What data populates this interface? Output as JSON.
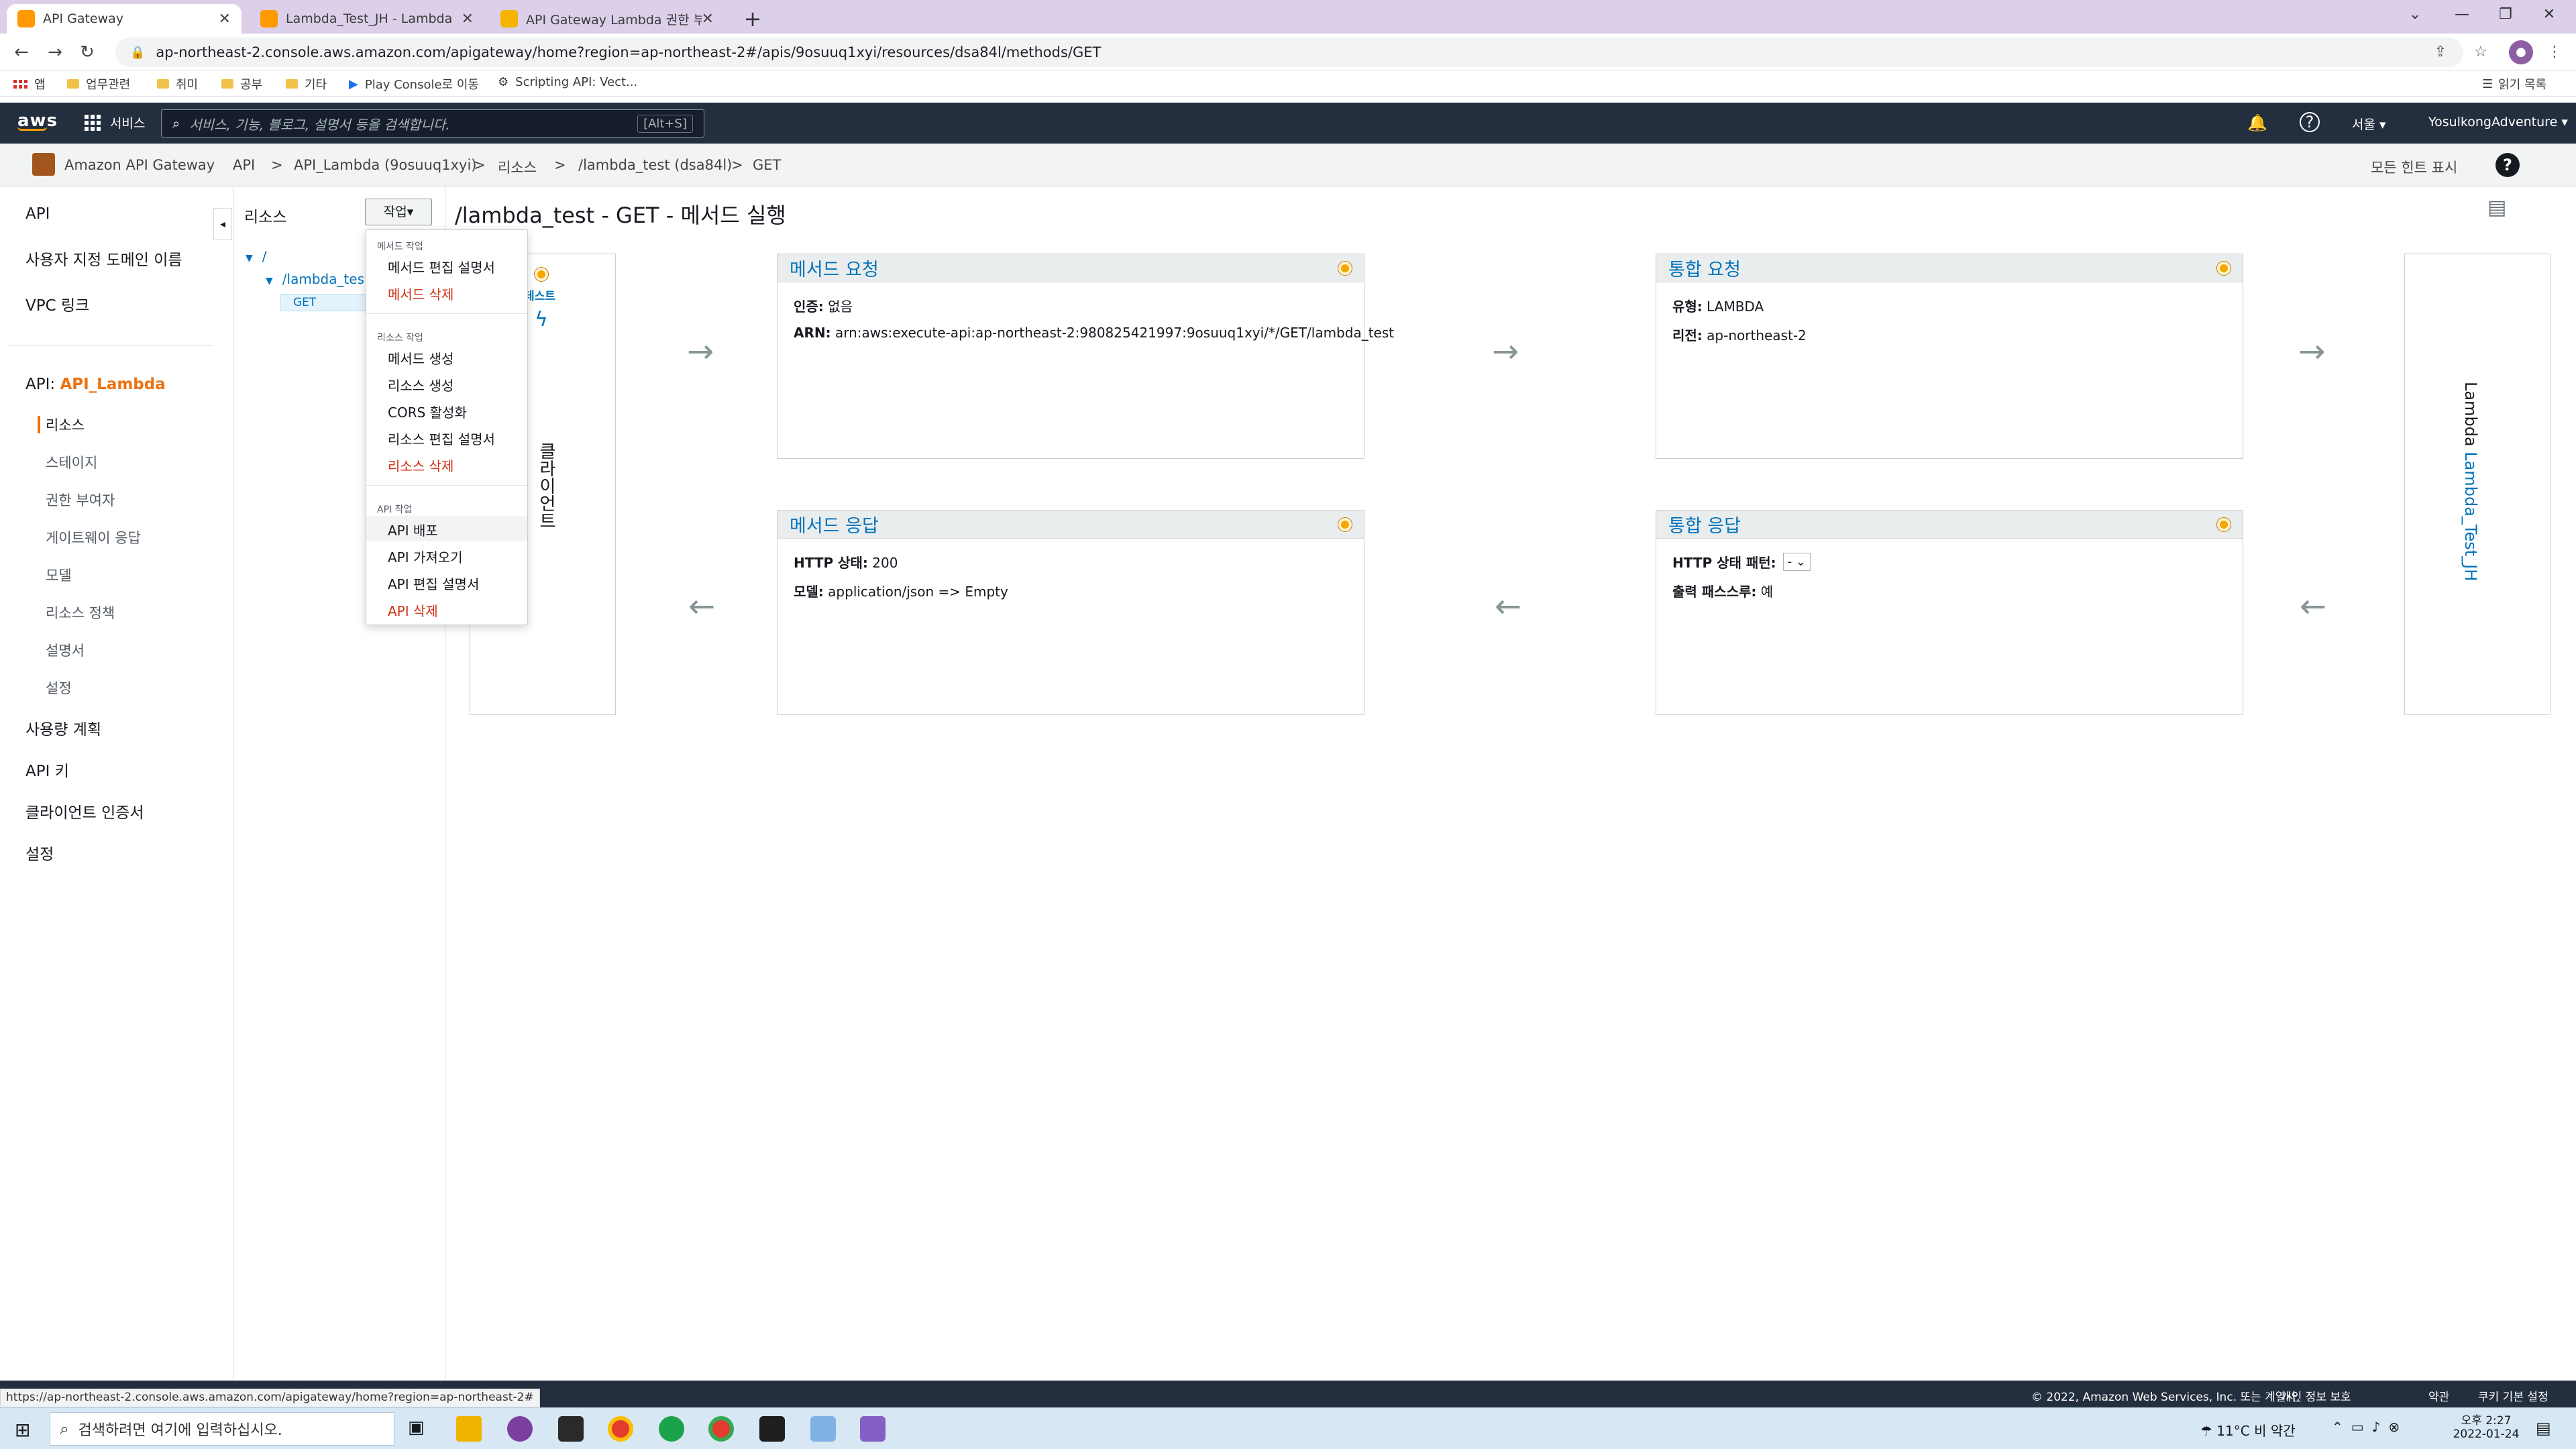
{
  "browser": {
    "tabs": [
      {
        "label": "API Gateway",
        "color": "#ff9900"
      },
      {
        "label": "Lambda_Test_JH - Lambda",
        "color": "#ff9900"
      },
      {
        "label": "API Gateway Lambda 권한 부여",
        "color": "#f4b400"
      }
    ],
    "url": "ap-northeast-2.console.aws.amazon.com/apigateway/home?region=ap-northeast-2#/apis/9osuuq1xyi/resources/dsa84l/methods/GET",
    "bookmarks": [
      "앱",
      "업무관련",
      "취미",
      "공부",
      "기타",
      "Play Console로 이동",
      "Scripting API: Vect..."
    ],
    "reading_list": "읽기 목록"
  },
  "aws_nav": {
    "logo": "aws",
    "services": "서비스",
    "search_placeholder": "서비스, 기능, 블로그, 설명서 등을 검색합니다.",
    "search_shortcut": "[Alt+S]",
    "region": "서울 ▾",
    "account": "YosulkongAdventure ▾"
  },
  "breadcrumb": {
    "service": "Amazon API Gateway",
    "items": [
      "API",
      ">",
      "API_Lambda (9osuuq1xyi)",
      ">",
      "리소스",
      ">",
      "/lambda_test (dsa84l)",
      ">",
      "GET"
    ],
    "hints": "모든 힌트 표시"
  },
  "sidebar": {
    "top": [
      "API",
      "사용자 지정 도메인 이름",
      "VPC 링크"
    ],
    "api_prefix": "API:",
    "api_name": "API_Lambda",
    "active": "리소스",
    "subs": [
      "스테이지",
      "권한 부여자",
      "게이트웨이 응답",
      "모델",
      "리소스 정책",
      "설명서",
      "설정"
    ],
    "bottom": [
      "사용량 계획",
      "API 키",
      "클라이언트 인증서",
      "설정"
    ]
  },
  "resources": {
    "title": "리소스",
    "actions_button": "작업▾",
    "tree": [
      "/",
      "/lambda_tes",
      "GET"
    ]
  },
  "action_menu": {
    "sections": [
      {
        "title": "메서드 작업",
        "items": [
          {
            "label": "메서드 편집 설명서",
            "danger": false
          },
          {
            "label": "메서드 삭제",
            "danger": true
          }
        ]
      },
      {
        "title": "리소스 작업",
        "items": [
          {
            "label": "메서드 생성",
            "danger": false
          },
          {
            "label": "리소스 생성",
            "danger": false
          },
          {
            "label": "CORS 활성화",
            "danger": false
          },
          {
            "label": "리소스 편집 설명서",
            "danger": false
          },
          {
            "label": "리소스 삭제",
            "danger": true
          }
        ]
      },
      {
        "title": "API 작업",
        "items": [
          {
            "label": "API 배포",
            "danger": false
          },
          {
            "label": "API 가져오기",
            "danger": false
          },
          {
            "label": "API 편집 설명서",
            "danger": false
          },
          {
            "label": "API 삭제",
            "danger": true
          }
        ]
      }
    ]
  },
  "page": {
    "title": "/lambda_test - GET - 메서드 실행",
    "client_label": "클라이언트",
    "test_label": "테스트",
    "method_request": {
      "title": "메서드 요청",
      "auth_label": "인증:",
      "auth_value": "없음",
      "arn_label": "ARN:",
      "arn_value": "arn:aws:execute-api:ap-northeast-2:980825421997:9osuuq1xyi/*/GET/lambda_test"
    },
    "integration_request": {
      "title": "통합 요청",
      "type_label": "유형:",
      "type_value": "LAMBDA",
      "region_label": "리전:",
      "region_value": "ap-northeast-2"
    },
    "method_response": {
      "title": "메서드 응답",
      "status_label": "HTTP 상태:",
      "status_value": "200",
      "model_label": "모델:",
      "model_value": "application/json => Empty"
    },
    "integration_response": {
      "title": "통합 응답",
      "pattern_label": "HTTP 상태 패턴:",
      "pattern_value": "-",
      "passthrough_label": "출력 패스스루:",
      "passthrough_value": "예"
    },
    "lambda_prefix": "Lambda",
    "lambda_name": "Lambda_Test_JH"
  },
  "footer": {
    "status_url": "https://ap-northeast-2.console.aws.amazon.com/apigateway/home?region=ap-northeast-2#",
    "copyright": "© 2022, Amazon Web Services, Inc. 또는 계열사.",
    "links": [
      "개인 정보 보호",
      "약관",
      "쿠키 기본 설정"
    ]
  },
  "taskbar": {
    "search_placeholder": "검색하려면 여기에 입력하십시오.",
    "weather": "11°C 비 약간",
    "time": "오후 2:27",
    "date": "2022-01-24"
  }
}
